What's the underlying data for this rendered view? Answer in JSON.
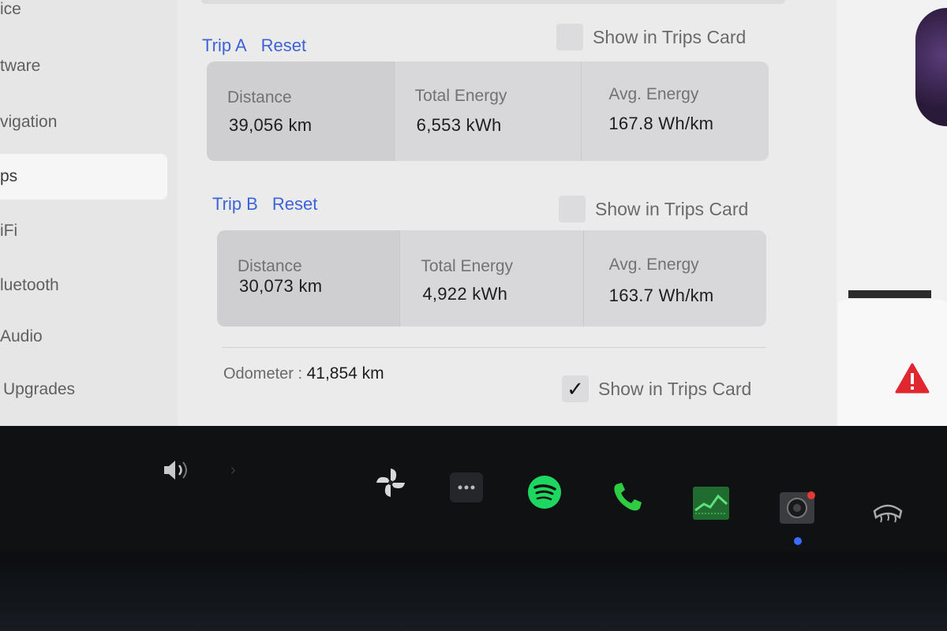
{
  "sidebar": {
    "items": [
      {
        "label": "ice"
      },
      {
        "label": "tware"
      },
      {
        "label": "vigation"
      },
      {
        "label": "ps"
      },
      {
        "label": "iFi"
      },
      {
        "label": "luetooth"
      },
      {
        "label": "Audio"
      },
      {
        "label": "Upgrades"
      }
    ]
  },
  "trip_a": {
    "title": "Trip A",
    "reset_label": "Reset",
    "show_label": "Show in Trips Card",
    "show_checked": false,
    "distance_label": "Distance",
    "distance_value": "39,056  km",
    "energy_label": "Total Energy",
    "energy_value": "6,553  kWh",
    "avg_label": "Avg. Energy",
    "avg_value": "167.8  Wh/km"
  },
  "trip_b": {
    "title": "Trip B",
    "reset_label": "Reset",
    "show_label": "Show in Trips Card",
    "show_checked": false,
    "distance_label": "Distance",
    "distance_value": "30,073  km",
    "energy_label": "Total Energy",
    "energy_value": "4,922  kWh",
    "avg_label": "Avg. Energy",
    "avg_value": "163.7  Wh/km"
  },
  "odometer": {
    "label": "Odometer  :",
    "value": "41,854  km",
    "show_label": "Show in Trips Card",
    "show_checked": true,
    "check_mark": "✓"
  },
  "dock": {
    "icons": [
      "volume-icon",
      "fan-icon",
      "more-icon",
      "spotify-icon",
      "phone-icon",
      "energy-chart-icon",
      "camera-icon",
      "rear-defrost-icon"
    ],
    "colors": {
      "spotify": "#1ed760",
      "phone": "#2ecc40",
      "chart": "#2fb34a",
      "camera_dot": "#e53935",
      "indicator": "#3c6cff"
    }
  },
  "colors": {
    "link": "#3e63d9",
    "warning": "#e0262e"
  }
}
